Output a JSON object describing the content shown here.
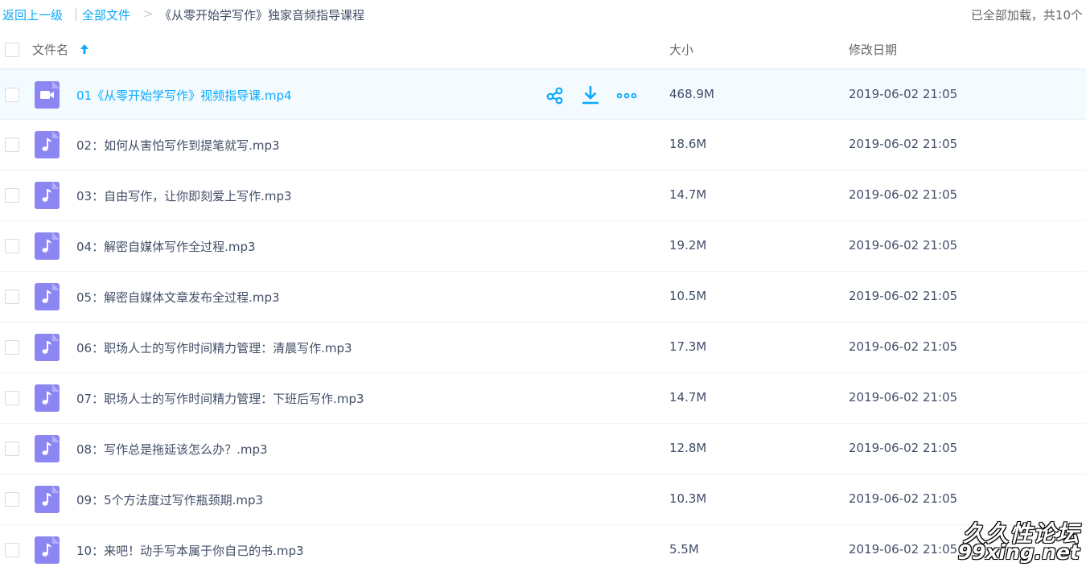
{
  "breadcrumb": {
    "back": "返回上一级",
    "separator": "|",
    "all_files": "全部文件",
    "arrow": ">",
    "current": "《从零开始学写作》独家音频指导课程"
  },
  "load_status": "已全部加载，共10个",
  "columns": {
    "name": "文件名",
    "size": "大小",
    "modified": "修改日期"
  },
  "colors": {
    "link": "#09aaff",
    "icon": "#8c86f2",
    "hover_row": "#f4fbff"
  },
  "files": [
    {
      "name": "01《从零开始学写作》视频指导课.mp4",
      "size": "468.9M",
      "date": "2019-06-02 21:05",
      "icon": "video-icon"
    },
    {
      "name": "02：如何从害怕写作到提笔就写.mp3",
      "size": "18.6M",
      "date": "2019-06-02 21:05",
      "icon": "music-note-icon"
    },
    {
      "name": "03：自由写作，让你即刻爱上写作.mp3",
      "size": "14.7M",
      "date": "2019-06-02 21:05",
      "icon": "music-note-icon"
    },
    {
      "name": "04：解密自媒体写作全过程.mp3",
      "size": "19.2M",
      "date": "2019-06-02 21:05",
      "icon": "music-note-icon"
    },
    {
      "name": "05：解密自媒体文章发布全过程.mp3",
      "size": "10.5M",
      "date": "2019-06-02 21:05",
      "icon": "music-note-icon"
    },
    {
      "name": "06：职场人士的写作时间精力管理：清晨写作.mp3",
      "size": "17.3M",
      "date": "2019-06-02 21:05",
      "icon": "music-note-icon"
    },
    {
      "name": "07：职场人士的写作时间精力管理：下班后写作.mp3",
      "size": "14.7M",
      "date": "2019-06-02 21:05",
      "icon": "music-note-icon"
    },
    {
      "name": "08：写作总是拖延该怎么办？.mp3",
      "size": "12.8M",
      "date": "2019-06-02 21:05",
      "icon": "music-note-icon"
    },
    {
      "name": "09：5个方法度过写作瓶颈期.mp3",
      "size": "10.3M",
      "date": "2019-06-02 21:05",
      "icon": "music-note-icon"
    },
    {
      "name": "10：来吧！动手写本属于你自己的书.mp3",
      "size": "5.5M",
      "date": "2019-06-02 21:05",
      "icon": "music-note-icon"
    }
  ],
  "watermark": {
    "line1": "久久性论坛",
    "line2": "99xing.net"
  }
}
